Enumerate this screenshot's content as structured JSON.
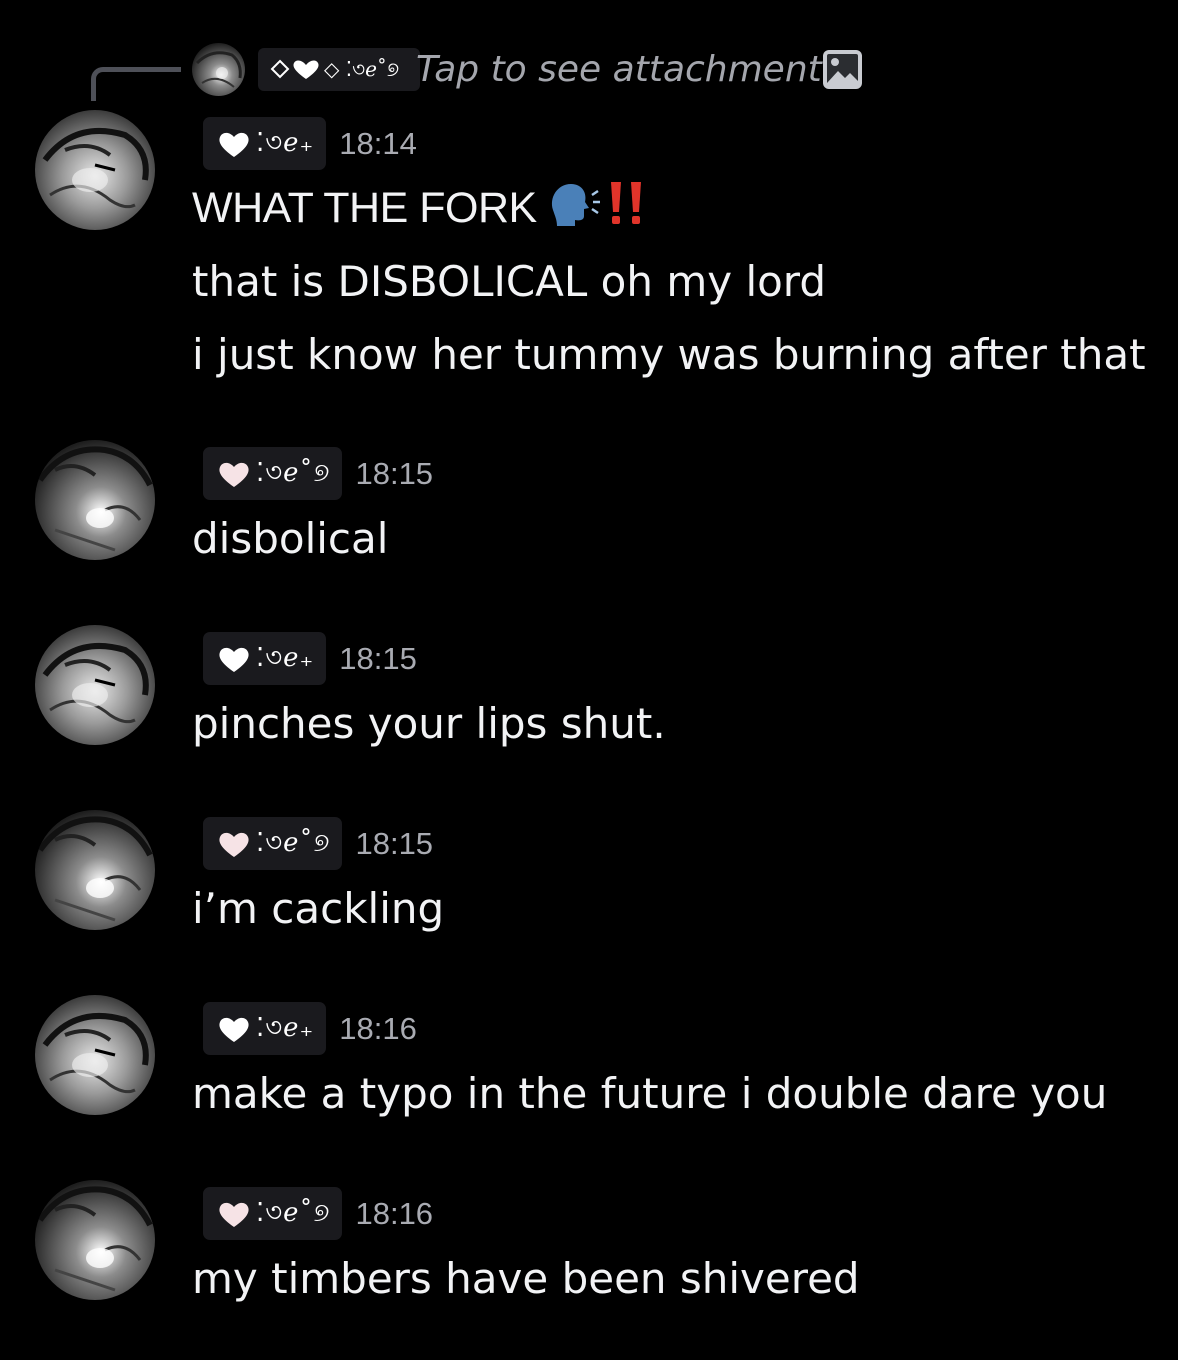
{
  "reply": {
    "name_glyphs": "◇ ⁚৩ℯ˚୭",
    "text": "Tap to see attachment",
    "icon": "image-icon"
  },
  "messages": [
    {
      "name_glyphs": "⁚৩ℯ₊",
      "timestamp": "18:14",
      "avatar_variant": "a",
      "lines": [
        "WHAT THE FORK",
        "that is DISBOLICAL oh my lord",
        "i just know her tummy was burning after that"
      ],
      "emojis": [
        "speaking-head-icon",
        "double-exclamation-icon"
      ]
    },
    {
      "name_glyphs": "⁚৩ℯ˚୭",
      "timestamp": "18:15",
      "avatar_variant": "b",
      "lines": [
        "disbolical"
      ]
    },
    {
      "name_glyphs": "⁚৩ℯ₊",
      "timestamp": "18:15",
      "avatar_variant": "a",
      "lines": [
        "pinches your lips shut."
      ]
    },
    {
      "name_glyphs": "⁚৩ℯ˚୭",
      "timestamp": "18:15",
      "avatar_variant": "b",
      "lines": [
        "i’m cackling"
      ]
    },
    {
      "name_glyphs": "⁚৩ℯ₊",
      "timestamp": "18:16",
      "avatar_variant": "a",
      "lines": [
        "make a typo in the future i double dare you"
      ]
    },
    {
      "name_glyphs": "⁚৩ℯ˚୭",
      "timestamp": "18:16",
      "avatar_variant": "b",
      "lines": [
        "my timbers have been shivered"
      ]
    }
  ],
  "colors": {
    "background": "#000000",
    "text": "#f2f3f5",
    "muted": "#a9abb2",
    "pill": "#1a1a1e",
    "heart_white": "#ffffff",
    "heart_pink": "#f6e3e6",
    "emoji_head": "#4a80b8",
    "emoji_bang": "#e0342a"
  }
}
